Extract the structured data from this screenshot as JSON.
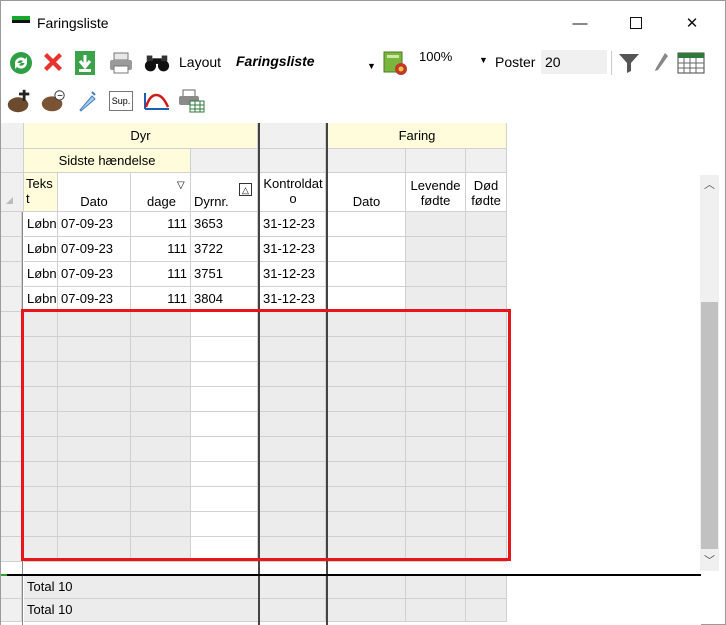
{
  "window": {
    "title": "Faringsliste"
  },
  "toolbar1": {
    "layout_label": "Layout",
    "layout_value": "Faringsliste",
    "zoom": "100%",
    "poster_label": "Poster",
    "poster_value": "20"
  },
  "toolbar2": {
    "sup_label": "Sup."
  },
  "grid": {
    "groups": {
      "dyr": "Dyr",
      "faring": "Faring",
      "sidste": "Sidste hændelse"
    },
    "columns": {
      "tekst": "Teks t",
      "dato": "Dato",
      "dage": "dage",
      "dyrnr": "Dyrnr.",
      "kontroldato": "Kontroldat o",
      "faring_dato": "Dato",
      "levende": "Levende fødte",
      "dod": "Død fødte"
    },
    "rows": [
      {
        "tekst": "Løbn",
        "dato": "07-09-23",
        "dage": "111",
        "dyrnr": "3653",
        "kontrol": "31-12-23"
      },
      {
        "tekst": "Løbn",
        "dato": "07-09-23",
        "dage": "111",
        "dyrnr": "3722",
        "kontrol": "31-12-23"
      },
      {
        "tekst": "Løbn",
        "dato": "07-09-23",
        "dage": "111",
        "dyrnr": "3751",
        "kontrol": "31-12-23"
      },
      {
        "tekst": "Løbn",
        "dato": "07-09-23",
        "dage": "111",
        "dyrnr": "3804",
        "kontrol": "31-12-23"
      }
    ],
    "totals": [
      "Total 10",
      "Total 10"
    ]
  },
  "icons": {
    "refresh": "refresh-icon",
    "delete": "delete-icon",
    "download": "download-icon",
    "print": "printer-icon",
    "find": "binoculars-icon",
    "settings": "settings-book-icon",
    "filter": "filter-icon",
    "tool": "wrench-icon",
    "calendar": "calendar-grid-icon"
  },
  "colors": {
    "selection": "#e8151b",
    "header_yellow": "#fffcdb",
    "cell_grey": "#ececec"
  }
}
